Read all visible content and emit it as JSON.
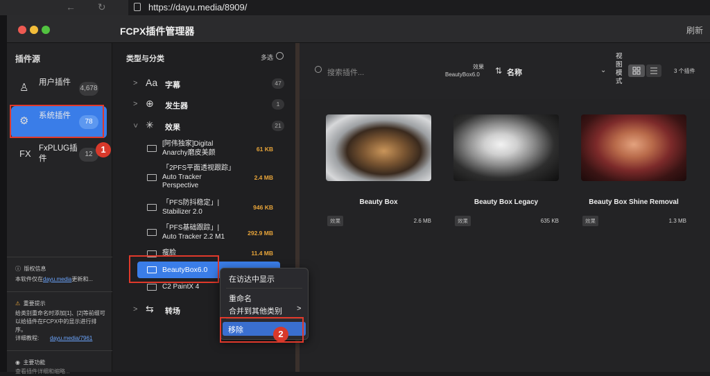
{
  "browser": {
    "nav_glyphs": "← ↻ ⌂",
    "url": "https://dayu.media/8909/"
  },
  "window": {
    "title": "FCPX插件管理器",
    "refresh_label": "刷新"
  },
  "sidebar": {
    "heading": "插件源",
    "items": [
      {
        "icon": "person-icon",
        "glyph": "♙",
        "label": "用户插件",
        "count": "4,678"
      },
      {
        "icon": "gear-icon",
        "glyph": "⚙",
        "label": "系统插件",
        "count": "78"
      },
      {
        "icon": "fx-icon",
        "glyph": "FX",
        "label": "FxPLUG插件",
        "count": "12"
      }
    ],
    "copyright_title": "版权信息",
    "copyright_text": "本软件仅在",
    "copyright_link": "dayu.media",
    "copyright_text2": "更新和...",
    "notice_title": "重要提示",
    "notice_text": "给类别重命名时添加[1]、[2]等前缀可以给插件在FCPX中的显示进行排序。",
    "tutorial_label": "详细教程:",
    "tutorial_link": "dayu.media/7961",
    "main_function": "主要功能",
    "main_function_sub": "查看插件详细和缩略..."
  },
  "categories": {
    "heading": "类型与分类",
    "multi_select": "多选",
    "rows": [
      {
        "glyph": "Aa",
        "label": "字幕",
        "count": "47",
        "icon": "text-icon"
      },
      {
        "glyph": "⊕",
        "label": "发生器",
        "count": "1",
        "icon": "generator-icon"
      },
      {
        "glyph": "✳",
        "label": "效果",
        "count": "21",
        "icon": "effects-icon"
      },
      {
        "glyph": "⇆",
        "label": "转场",
        "icon": "transition-icon"
      }
    ],
    "subfolders": [
      {
        "label": "[阿伟独家]Digital Anarchy磨皮美颜",
        "size": "61 KB"
      },
      {
        "label": "「2PFS平面透视跟踪」Auto Tracker Perspective",
        "size": "2.4 MB"
      },
      {
        "label": "「PFS防抖稳定」| Stabilizer 2.0",
        "size": "946 KB"
      },
      {
        "label": "「PFS基础跟踪」| Auto Tracker 2.2 M1",
        "size": "292.9 MB"
      },
      {
        "label": "瘦脸",
        "size": "11.4 MB"
      },
      {
        "label": "BeautyBox6.0",
        "size": ""
      },
      {
        "label": "C2 PaintX 4",
        "size": ""
      }
    ]
  },
  "toolbar": {
    "search_placeholder": "搜索插件...",
    "crumb_top": "效果",
    "crumb_bottom": "BeautyBox6.0",
    "sort_label": "名称",
    "view_label": "视图模式",
    "count_label": "3 个插件"
  },
  "cards": [
    {
      "title": "Beauty Box",
      "tag": "效果",
      "size": "2.6 MB"
    },
    {
      "title": "Beauty Box Legacy",
      "tag": "效果",
      "size": "635 KB"
    },
    {
      "title": "Beauty Box Shine Removal",
      "tag": "效果",
      "size": "1.3 MB"
    }
  ],
  "context_menu": {
    "show_in_finder": "在访达中显示",
    "rename": "重命名",
    "merge": "合并到其他类别",
    "remove": "移除"
  },
  "annotations": {
    "step1": "1",
    "step2": "2"
  },
  "colors": {
    "accent": "#3a7de8",
    "annotation_red": "#e0392b",
    "size_orange": "#e8a53a"
  }
}
